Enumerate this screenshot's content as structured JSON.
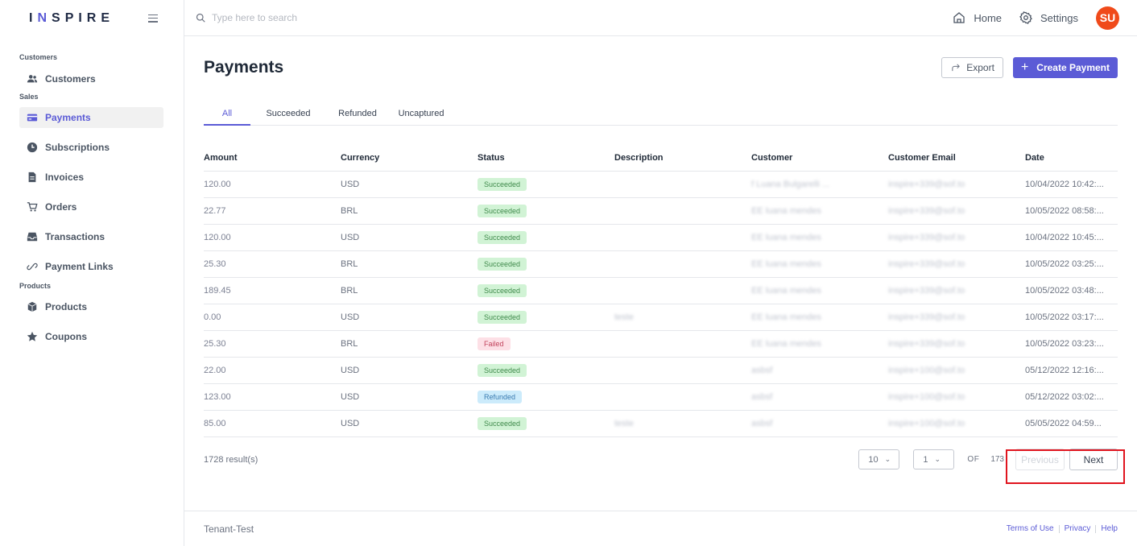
{
  "brand": {
    "logo_part1": "I",
    "logo_accent": "N",
    "logo_part2": "SPIRE"
  },
  "search": {
    "placeholder": "Type here to search"
  },
  "topbar": {
    "home_label": "Home",
    "settings_label": "Settings",
    "avatar_initials": "SU"
  },
  "sidebar": {
    "sections": {
      "customers": "Customers",
      "sales": "Sales",
      "products": "Products"
    },
    "items": [
      {
        "label": "Customers",
        "icon": "users-icon"
      },
      {
        "label": "Payments",
        "icon": "credit-card-icon",
        "active": true
      },
      {
        "label": "Subscriptions",
        "icon": "clock-icon"
      },
      {
        "label": "Invoices",
        "icon": "document-icon"
      },
      {
        "label": "Orders",
        "icon": "cart-icon"
      },
      {
        "label": "Transactions",
        "icon": "inbox-icon"
      },
      {
        "label": "Payment Links",
        "icon": "link-icon"
      },
      {
        "label": "Products",
        "icon": "cube-icon"
      },
      {
        "label": "Coupons",
        "icon": "star-icon"
      }
    ]
  },
  "page": {
    "title": "Payments",
    "export_label": "Export",
    "create_label": "Create Payment"
  },
  "tabs": [
    "All",
    "Succeeded",
    "Refunded",
    "Uncaptured"
  ],
  "table": {
    "columns": [
      "Amount",
      "Currency",
      "Status",
      "Description",
      "Customer",
      "Customer Email",
      "Date"
    ],
    "rows": [
      {
        "amount": "120.00",
        "currency": "USD",
        "status": "Succeeded",
        "description": "",
        "customer": "f Luana Bulgarelli ...",
        "email": "inspire+339@sof.to",
        "date": "10/04/2022 10:42:..."
      },
      {
        "amount": "22.77",
        "currency": "BRL",
        "status": "Succeeded",
        "description": "",
        "customer": "EE luana mendes",
        "email": "inspire+339@sof.to",
        "date": "10/05/2022 08:58:..."
      },
      {
        "amount": "120.00",
        "currency": "USD",
        "status": "Succeeded",
        "description": "",
        "customer": "EE luana mendes",
        "email": "inspire+339@sof.to",
        "date": "10/04/2022 10:45:..."
      },
      {
        "amount": "25.30",
        "currency": "BRL",
        "status": "Succeeded",
        "description": "",
        "customer": "EE luana mendes",
        "email": "inspire+339@sof.to",
        "date": "10/05/2022 03:25:..."
      },
      {
        "amount": "189.45",
        "currency": "BRL",
        "status": "Succeeded",
        "description": "",
        "customer": "EE luana mendes",
        "email": "inspire+339@sof.to",
        "date": "10/05/2022 03:48:..."
      },
      {
        "amount": "0.00",
        "currency": "USD",
        "status": "Succeeded",
        "description": "teste",
        "customer": "EE luana mendes",
        "email": "inspire+339@sof.to",
        "date": "10/05/2022 03:17:..."
      },
      {
        "amount": "25.30",
        "currency": "BRL",
        "status": "Failed",
        "description": "",
        "customer": "EE luana mendes",
        "email": "inspire+339@sof.to",
        "date": "10/05/2022 03:23:..."
      },
      {
        "amount": "22.00",
        "currency": "USD",
        "status": "Succeeded",
        "description": "",
        "customer": "asbsf",
        "email": "inspire+100@sof.to",
        "date": "05/12/2022 12:16:..."
      },
      {
        "amount": "123.00",
        "currency": "USD",
        "status": "Refunded",
        "description": "",
        "customer": "asbsf",
        "email": "inspire+100@sof.to",
        "date": "05/12/2022 03:02:..."
      },
      {
        "amount": "85.00",
        "currency": "USD",
        "status": "Succeeded",
        "description": "teste",
        "customer": "asbsf",
        "email": "inspire+100@sof.to",
        "date": "05/05/2022 04:59..."
      }
    ]
  },
  "pagination": {
    "results": "1728 result(s)",
    "page_size": "10",
    "current_page": "1",
    "of_label": "OF",
    "total_pages": "173",
    "previous_label": "Previous",
    "next_label": "Next"
  },
  "footer": {
    "tenant": "Tenant-Test",
    "links": [
      "Terms of Use",
      "Privacy",
      "Help"
    ]
  },
  "colors": {
    "accent": "#5b5bd6",
    "avatar": "#f04a1a",
    "highlight": "#e0141e"
  }
}
